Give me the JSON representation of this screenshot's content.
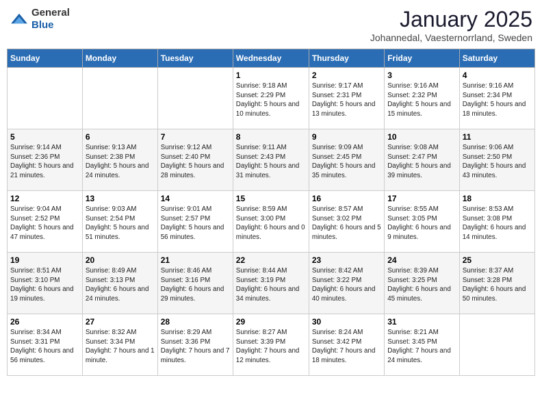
{
  "header": {
    "logo": {
      "general": "General",
      "blue": "Blue"
    },
    "title": "January 2025",
    "location": "Johannedal, Vaesternorrland, Sweden"
  },
  "calendar": {
    "days_of_week": [
      "Sunday",
      "Monday",
      "Tuesday",
      "Wednesday",
      "Thursday",
      "Friday",
      "Saturday"
    ],
    "weeks": [
      [
        {
          "day": "",
          "info": ""
        },
        {
          "day": "",
          "info": ""
        },
        {
          "day": "",
          "info": ""
        },
        {
          "day": "1",
          "info": "Sunrise: 9:18 AM\nSunset: 2:29 PM\nDaylight: 5 hours\nand 10 minutes."
        },
        {
          "day": "2",
          "info": "Sunrise: 9:17 AM\nSunset: 2:31 PM\nDaylight: 5 hours\nand 13 minutes."
        },
        {
          "day": "3",
          "info": "Sunrise: 9:16 AM\nSunset: 2:32 PM\nDaylight: 5 hours\nand 15 minutes."
        },
        {
          "day": "4",
          "info": "Sunrise: 9:16 AM\nSunset: 2:34 PM\nDaylight: 5 hours\nand 18 minutes."
        }
      ],
      [
        {
          "day": "5",
          "info": "Sunrise: 9:14 AM\nSunset: 2:36 PM\nDaylight: 5 hours\nand 21 minutes."
        },
        {
          "day": "6",
          "info": "Sunrise: 9:13 AM\nSunset: 2:38 PM\nDaylight: 5 hours\nand 24 minutes."
        },
        {
          "day": "7",
          "info": "Sunrise: 9:12 AM\nSunset: 2:40 PM\nDaylight: 5 hours\nand 28 minutes."
        },
        {
          "day": "8",
          "info": "Sunrise: 9:11 AM\nSunset: 2:43 PM\nDaylight: 5 hours\nand 31 minutes."
        },
        {
          "day": "9",
          "info": "Sunrise: 9:09 AM\nSunset: 2:45 PM\nDaylight: 5 hours\nand 35 minutes."
        },
        {
          "day": "10",
          "info": "Sunrise: 9:08 AM\nSunset: 2:47 PM\nDaylight: 5 hours\nand 39 minutes."
        },
        {
          "day": "11",
          "info": "Sunrise: 9:06 AM\nSunset: 2:50 PM\nDaylight: 5 hours\nand 43 minutes."
        }
      ],
      [
        {
          "day": "12",
          "info": "Sunrise: 9:04 AM\nSunset: 2:52 PM\nDaylight: 5 hours\nand 47 minutes."
        },
        {
          "day": "13",
          "info": "Sunrise: 9:03 AM\nSunset: 2:54 PM\nDaylight: 5 hours\nand 51 minutes."
        },
        {
          "day": "14",
          "info": "Sunrise: 9:01 AM\nSunset: 2:57 PM\nDaylight: 5 hours\nand 56 minutes."
        },
        {
          "day": "15",
          "info": "Sunrise: 8:59 AM\nSunset: 3:00 PM\nDaylight: 6 hours\nand 0 minutes."
        },
        {
          "day": "16",
          "info": "Sunrise: 8:57 AM\nSunset: 3:02 PM\nDaylight: 6 hours\nand 5 minutes."
        },
        {
          "day": "17",
          "info": "Sunrise: 8:55 AM\nSunset: 3:05 PM\nDaylight: 6 hours\nand 9 minutes."
        },
        {
          "day": "18",
          "info": "Sunrise: 8:53 AM\nSunset: 3:08 PM\nDaylight: 6 hours\nand 14 minutes."
        }
      ],
      [
        {
          "day": "19",
          "info": "Sunrise: 8:51 AM\nSunset: 3:10 PM\nDaylight: 6 hours\nand 19 minutes."
        },
        {
          "day": "20",
          "info": "Sunrise: 8:49 AM\nSunset: 3:13 PM\nDaylight: 6 hours\nand 24 minutes."
        },
        {
          "day": "21",
          "info": "Sunrise: 8:46 AM\nSunset: 3:16 PM\nDaylight: 6 hours\nand 29 minutes."
        },
        {
          "day": "22",
          "info": "Sunrise: 8:44 AM\nSunset: 3:19 PM\nDaylight: 6 hours\nand 34 minutes."
        },
        {
          "day": "23",
          "info": "Sunrise: 8:42 AM\nSunset: 3:22 PM\nDaylight: 6 hours\nand 40 minutes."
        },
        {
          "day": "24",
          "info": "Sunrise: 8:39 AM\nSunset: 3:25 PM\nDaylight: 6 hours\nand 45 minutes."
        },
        {
          "day": "25",
          "info": "Sunrise: 8:37 AM\nSunset: 3:28 PM\nDaylight: 6 hours\nand 50 minutes."
        }
      ],
      [
        {
          "day": "26",
          "info": "Sunrise: 8:34 AM\nSunset: 3:31 PM\nDaylight: 6 hours\nand 56 minutes."
        },
        {
          "day": "27",
          "info": "Sunrise: 8:32 AM\nSunset: 3:34 PM\nDaylight: 7 hours\nand 1 minute."
        },
        {
          "day": "28",
          "info": "Sunrise: 8:29 AM\nSunset: 3:36 PM\nDaylight: 7 hours\nand 7 minutes."
        },
        {
          "day": "29",
          "info": "Sunrise: 8:27 AM\nSunset: 3:39 PM\nDaylight: 7 hours\nand 12 minutes."
        },
        {
          "day": "30",
          "info": "Sunrise: 8:24 AM\nSunset: 3:42 PM\nDaylight: 7 hours\nand 18 minutes."
        },
        {
          "day": "31",
          "info": "Sunrise: 8:21 AM\nSunset: 3:45 PM\nDaylight: 7 hours\nand 24 minutes."
        },
        {
          "day": "",
          "info": ""
        }
      ]
    ]
  }
}
